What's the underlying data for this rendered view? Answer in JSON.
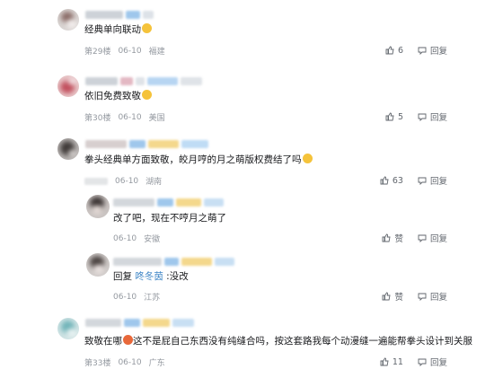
{
  "colors": {
    "text": "#18191c",
    "meta": "#9499a0",
    "action": "#61666d",
    "link": "#3f86c6"
  },
  "comments": [
    {
      "text": "经典单向联动",
      "emoji": "smile",
      "floor": "第29楼",
      "date": "06-10",
      "location": "福建",
      "likes": "6",
      "reply": "回复"
    },
    {
      "text": "依旧免费致敬",
      "emoji": "smile",
      "floor": "第30楼",
      "date": "06-10",
      "location": "美国",
      "likes": "5",
      "reply": "回复"
    },
    {
      "text": "拳头经典单方面致敬，皎月哼的月之萌版权费结了吗",
      "emoji": "smile",
      "floor": "",
      "date": "06-10",
      "location": "湖南",
      "likes": "63",
      "reply": "回复"
    },
    {
      "text": "改了吧，现在不哼月之萌了",
      "date": "06-10",
      "location": "安徽",
      "like_label": "赞",
      "reply": "回复"
    },
    {
      "reply_prefix": "回复 ",
      "reply_to": "咚冬茵",
      "text": " :没改",
      "date": "06-10",
      "location": "江苏",
      "like_label": "赞",
      "reply": "回复"
    },
    {
      "text": "致敬在哪",
      "text2": "这不是屁自己东西没有纯缝合吗，按这套路我每个动漫缝一遍能帮拳头设计到关服",
      "floor": "第33楼",
      "date": "06-10",
      "location": "广东",
      "likes": "11",
      "reply": "回复"
    }
  ]
}
